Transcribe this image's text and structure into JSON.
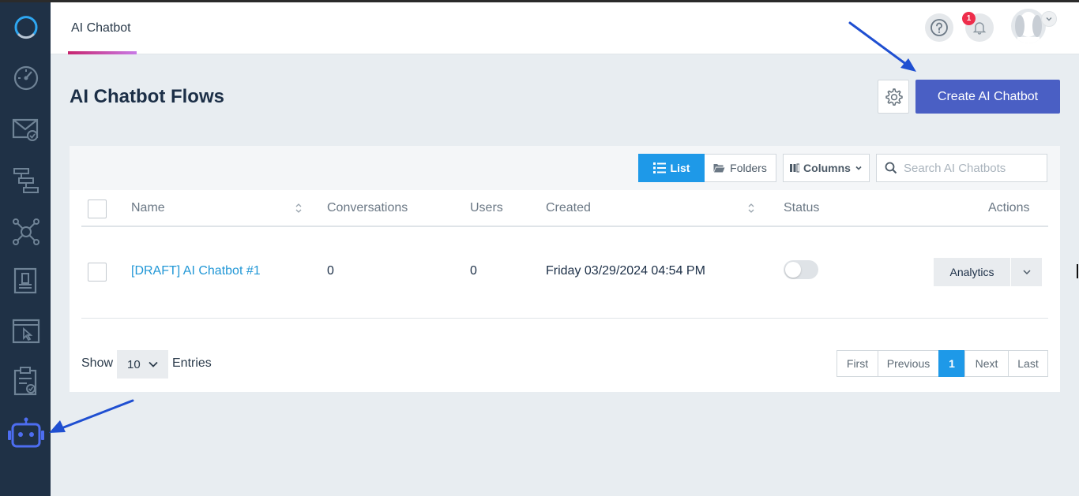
{
  "header": {
    "tab_label": "AI Chatbot",
    "notification_count": "1"
  },
  "sidebar": {
    "items": [
      {
        "icon": "logo-icon"
      },
      {
        "icon": "dashboard-gauge-icon"
      },
      {
        "icon": "email-campaign-icon"
      },
      {
        "icon": "automation-flow-icon"
      },
      {
        "icon": "network-hub-icon"
      },
      {
        "icon": "forms-document-icon"
      },
      {
        "icon": "web-page-icon"
      },
      {
        "icon": "clipboard-check-icon"
      },
      {
        "icon": "ai-chatbot-robot-icon",
        "active": true
      }
    ]
  },
  "page": {
    "title": "AI Chatbot Flows",
    "create_button": "Create AI Chatbot"
  },
  "toolbar": {
    "list_label": "List",
    "folders_label": "Folders",
    "columns_label": "Columns",
    "search_placeholder": "Search AI Chatbots"
  },
  "table": {
    "columns": [
      "Name",
      "Conversations",
      "Users",
      "Created",
      "Status",
      "Actions"
    ],
    "rows": [
      {
        "name": "[DRAFT] AI Chatbot #1",
        "conversations": "0",
        "users": "0",
        "created": "Friday 03/29/2024 04:54 PM",
        "status_on": false,
        "action": "Analytics"
      }
    ]
  },
  "footer": {
    "show_label": "Show",
    "page_size": "10",
    "entries_label": "Entries",
    "pagination": [
      "First",
      "Previous",
      "1",
      "Next",
      "Last"
    ],
    "current_page": "1"
  },
  "colors": {
    "sidebar_bg": "#1f3146",
    "primary_button": "#4a5fc4",
    "active_blue": "#1e99e8",
    "link": "#2197d6",
    "annotation_arrow": "#1f4fd1"
  }
}
